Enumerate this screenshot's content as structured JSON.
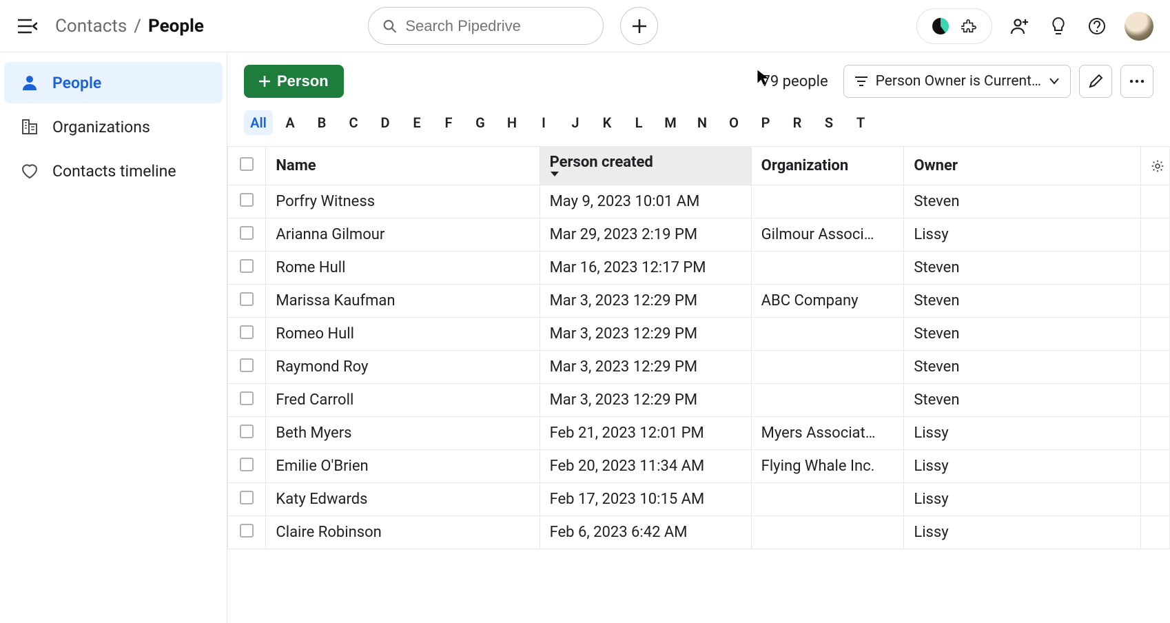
{
  "breadcrumb": {
    "root": "Contacts",
    "leaf": "People"
  },
  "search": {
    "placeholder": "Search Pipedrive"
  },
  "sidebar": {
    "items": [
      {
        "label": "People",
        "icon": "person-icon",
        "active": true
      },
      {
        "label": "Organizations",
        "icon": "building-icon",
        "active": false
      },
      {
        "label": "Contacts timeline",
        "icon": "heart-icon",
        "active": false
      }
    ]
  },
  "toolbar": {
    "add_label": "Person",
    "count_label": "79 people",
    "filter_label": "Person Owner is Current…"
  },
  "alpha": [
    "All",
    "A",
    "B",
    "C",
    "D",
    "E",
    "F",
    "G",
    "H",
    "I",
    "J",
    "K",
    "L",
    "M",
    "N",
    "O",
    "P",
    "R",
    "S",
    "T"
  ],
  "columns": [
    {
      "key": "name",
      "label": "Name"
    },
    {
      "key": "created",
      "label": "Person created",
      "sort": "desc"
    },
    {
      "key": "org",
      "label": "Organization"
    },
    {
      "key": "owner",
      "label": "Owner"
    }
  ],
  "rows": [
    {
      "name": "Porfry Witness",
      "created": "May 9, 2023 10:01 AM",
      "org": "",
      "owner": "Steven"
    },
    {
      "name": "Arianna Gilmour",
      "created": "Mar 29, 2023 2:19 PM",
      "org": "Gilmour Associ…",
      "owner": "Lissy"
    },
    {
      "name": "Rome Hull",
      "created": "Mar 16, 2023 12:17 PM",
      "org": "",
      "owner": "Steven"
    },
    {
      "name": "Marissa Kaufman",
      "created": "Mar 3, 2023 12:29 PM",
      "org": "ABC Company",
      "owner": "Steven"
    },
    {
      "name": "Romeo Hull",
      "created": "Mar 3, 2023 12:29 PM",
      "org": "",
      "owner": "Steven"
    },
    {
      "name": "Raymond Roy",
      "created": "Mar 3, 2023 12:29 PM",
      "org": "",
      "owner": "Steven"
    },
    {
      "name": "Fred Carroll",
      "created": "Mar 3, 2023 12:29 PM",
      "org": "",
      "owner": "Steven"
    },
    {
      "name": "Beth Myers",
      "created": "Feb 21, 2023 12:01 PM",
      "org": "Myers Associat…",
      "owner": "Lissy"
    },
    {
      "name": "Emilie O'Brien",
      "created": "Feb 20, 2023 11:34 AM",
      "org": "Flying Whale Inc.",
      "owner": "Lissy"
    },
    {
      "name": "Katy Edwards",
      "created": "Feb 17, 2023 10:15 AM",
      "org": "",
      "owner": "Lissy"
    },
    {
      "name": "Claire Robinson",
      "created": "Feb 6, 2023 6:42 AM",
      "org": "",
      "owner": "Lissy"
    }
  ]
}
